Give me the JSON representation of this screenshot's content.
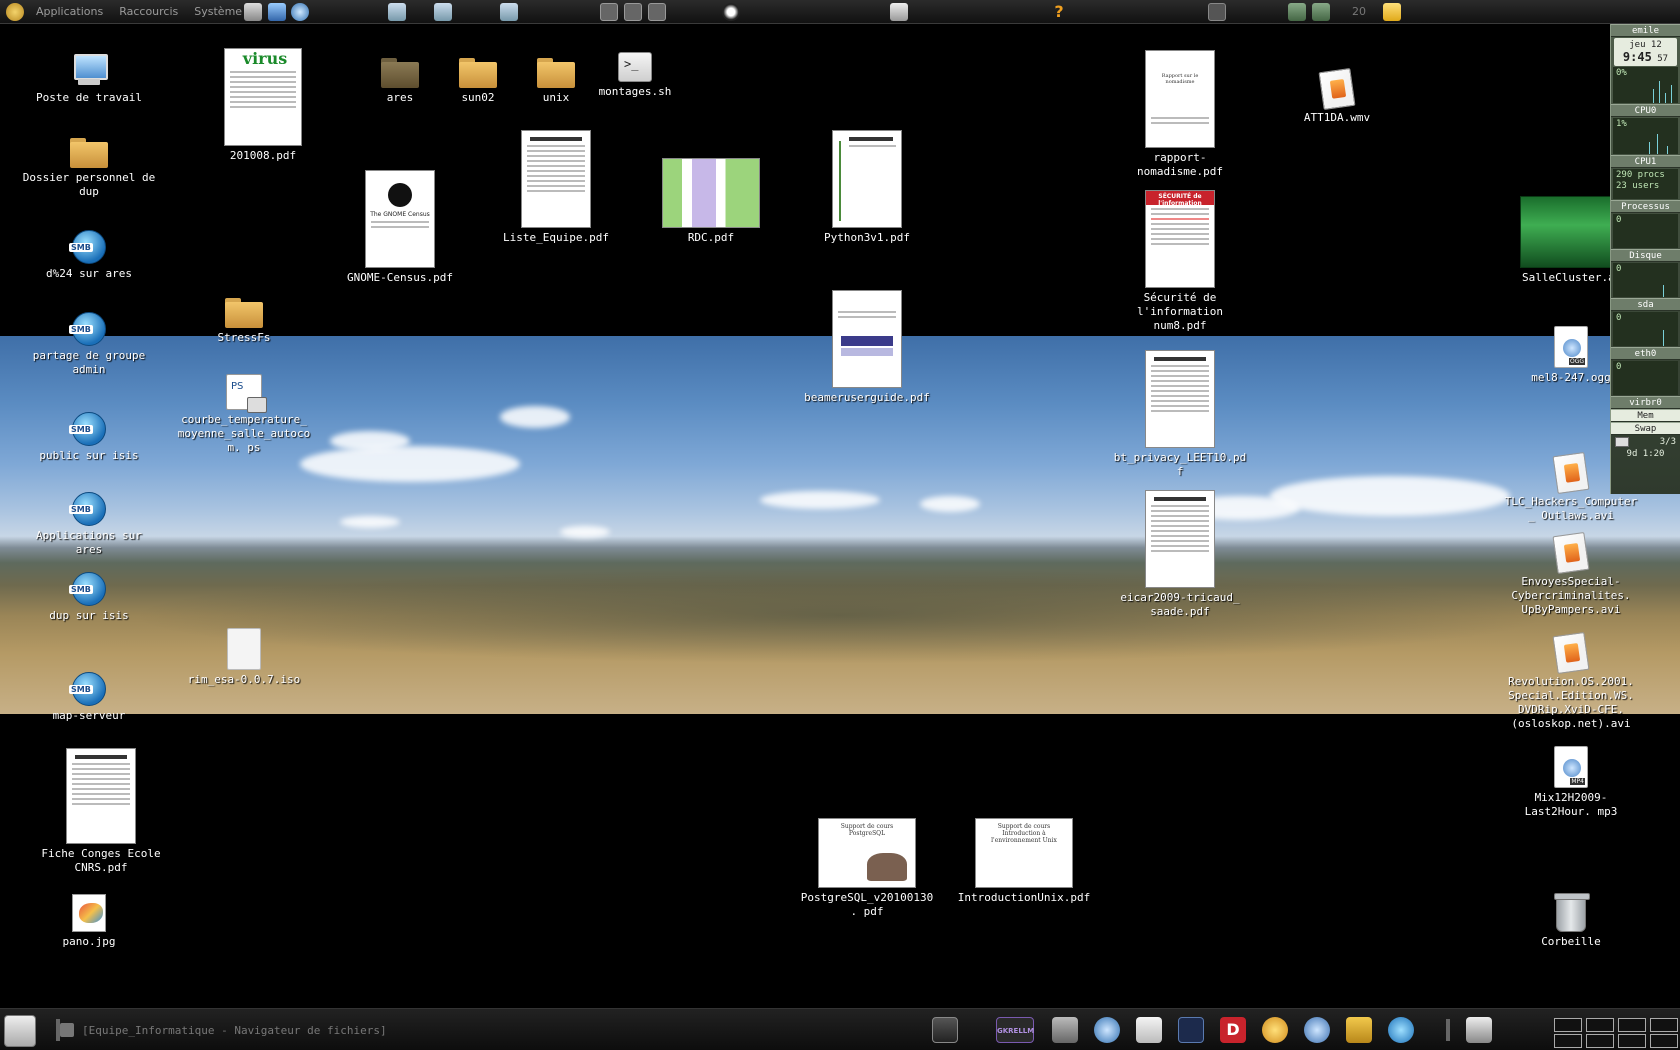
{
  "top_panel": {
    "menus": [
      "Applications",
      "Raccourcis",
      "Système"
    ],
    "clock_partial": "20"
  },
  "desktop": {
    "icons": {
      "poste_de_travail": "Poste de travail",
      "dossier_personnel": "Dossier personnel de dup",
      "d24_sur_ares": "d%24 sur ares",
      "partage_de_groupe": "partage de groupe admin",
      "public_sur_isis": "public sur isis",
      "applications_sur_ares": "Applications sur ares",
      "dup_sur_isis": "dup sur isis",
      "map_serveur": "map-serveur",
      "fiche_conges": "Fiche Conges Ecole CNRS.pdf",
      "pano": "pano.jpg",
      "f201008": "201008.pdf",
      "stressfs": "StressFs",
      "courbe": "courbe_temperature_ moyenne_salle_autocom. ps",
      "rim_esa": "rim_esa-0.0.7.iso",
      "ares": "ares",
      "gnome_census": "GNOME-Census.pdf",
      "sun02": "sun02",
      "unix": "unix",
      "liste_equipe": "Liste_Equipe.pdf",
      "montages": "montages.sh",
      "rdc": "RDC.pdf",
      "python3": "Python3v1.pdf",
      "beamer": "beameruserguide.pdf",
      "postgresql": "PostgreSQL_v20100130. pdf",
      "introunix": "IntroductionUnix.pdf",
      "rapport": "rapport-nomadisme.pdf",
      "securite": "Sécurité de l'information num8.pdf",
      "bt_privacy": "bt_privacy_LEET10.pdf",
      "eicar": "eicar2009-tricaud_ saade.pdf",
      "att1da": "ATT1DA.wmv",
      "sallecluster": "SalleCluster.avi",
      "mel8": "mel8-247.ogg",
      "tlc": "TLC_Hackers_Computer_ Outlaws.avi",
      "envoyes": "EnvoyesSpecial- Cybercriminalites. UpByPampers.avi",
      "revolution": "Revolution.OS.2001. Special.Edition.WS. DVDRip.XviD-CFE. (osloskop.net).avi",
      "mix12h": "Mix12H2009-Last2Hour. mp3",
      "corbeille": "Corbeille"
    },
    "thumb_text": {
      "virus": "virus",
      "gnome": "The GNOME Census",
      "postgres": "Support de cours PostgreSQL",
      "introunix": "Support de cours Introduction à l'environnement Unix",
      "securite": "SÉCURITÉ de l'information",
      "rapport": "Rapport sur le nomadisme"
    }
  },
  "gkrellm": {
    "user": "emile",
    "date": "jeu 12",
    "time": "9:45",
    "seconds": "57",
    "cpu0_label": "CPU0",
    "cpu0_val": "0%",
    "cpu1_label": "CPU1",
    "cpu1_val": "1%",
    "procs": "290 procs",
    "users": "23 users",
    "processus": "Processus",
    "processus_val": "0",
    "disque": "Disque",
    "disque_val": "0",
    "sda": "sda",
    "sda_val": "0",
    "eth0": "eth0",
    "eth0_val": "0",
    "virbr0": "virbr0",
    "mem": "Mem",
    "swap": "Swap",
    "mails": "3/3",
    "uptime": "9d 1:20"
  },
  "bottom_panel": {
    "task": "[Equipe_Informatique - Navigateur de fichiers]",
    "gkrellm_tray": "GKRELLM"
  }
}
